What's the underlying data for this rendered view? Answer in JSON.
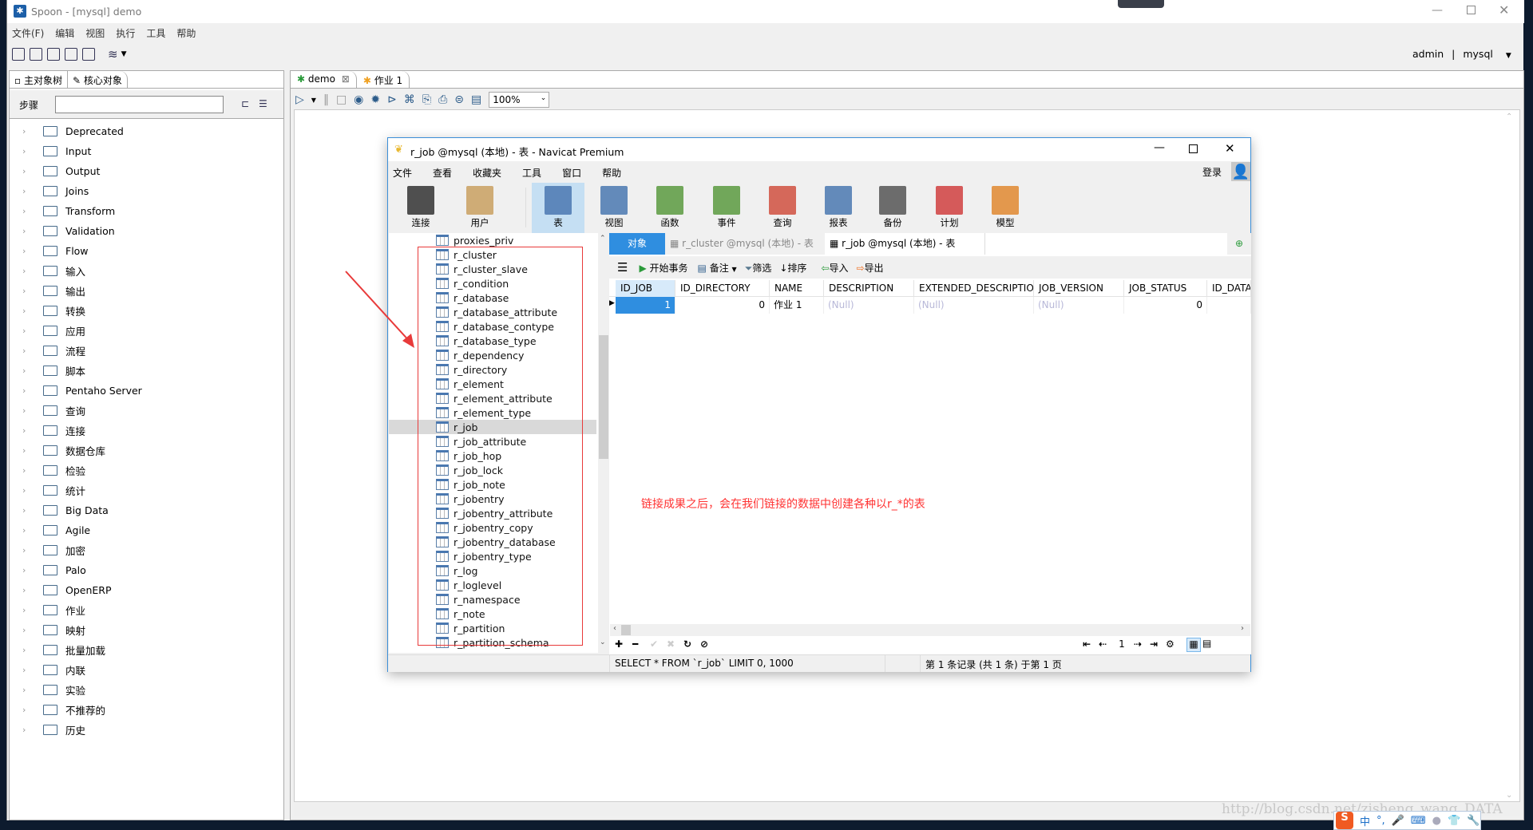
{
  "spoon": {
    "title": "Spoon - [mysql] demo",
    "menu": [
      "文件(F)",
      "编辑",
      "视图",
      "执行",
      "工具",
      "帮助"
    ],
    "user": "admin",
    "separator": "|",
    "repository": "mysql",
    "left_tabs": [
      "主对象树",
      "核心对象"
    ],
    "steps_label": "步骤",
    "steps_search_value": "",
    "tree": [
      "Deprecated",
      "Input",
      "Output",
      "Joins",
      "Transform",
      "Validation",
      "Flow",
      "输入",
      "输出",
      "转换",
      "应用",
      "流程",
      "脚本",
      "Pentaho Server",
      "查询",
      "连接",
      "数据仓库",
      "检验",
      "统计",
      "Big Data",
      "Agile",
      "加密",
      "Palo",
      "OpenERP",
      "作业",
      "映射",
      "批量加载",
      "内联",
      "实验",
      "不推荐的",
      "历史"
    ],
    "editor_tabs": [
      {
        "label": "demo",
        "closable": true
      },
      {
        "label": "作业 1",
        "closable": false
      }
    ],
    "zoom": "100%"
  },
  "navicat": {
    "title": "r_job @mysql (本地) - 表 - Navicat Premium",
    "menu": [
      "文件",
      "查看",
      "收藏夹",
      "工具",
      "窗口",
      "帮助"
    ],
    "login": "登录",
    "toolbar": [
      {
        "label": "连接",
        "icon": "connection-icon"
      },
      {
        "label": "用户",
        "icon": "user-icon"
      },
      {
        "label": "表",
        "icon": "table-icon",
        "active": true
      },
      {
        "label": "视图",
        "icon": "view-icon"
      },
      {
        "label": "函数",
        "icon": "function-icon"
      },
      {
        "label": "事件",
        "icon": "event-icon"
      },
      {
        "label": "查询",
        "icon": "query-icon"
      },
      {
        "label": "报表",
        "icon": "report-icon"
      },
      {
        "label": "备份",
        "icon": "backup-icon"
      },
      {
        "label": "计划",
        "icon": "schedule-icon"
      },
      {
        "label": "模型",
        "icon": "model-icon"
      }
    ],
    "tables": [
      "proxies_priv",
      "r_cluster",
      "r_cluster_slave",
      "r_condition",
      "r_database",
      "r_database_attribute",
      "r_database_contype",
      "r_database_type",
      "r_dependency",
      "r_directory",
      "r_element",
      "r_element_attribute",
      "r_element_type",
      "r_job",
      "r_job_attribute",
      "r_job_hop",
      "r_job_lock",
      "r_job_note",
      "r_jobentry",
      "r_jobentry_attribute",
      "r_jobentry_copy",
      "r_jobentry_database",
      "r_jobentry_type",
      "r_log",
      "r_loglevel",
      "r_namespace",
      "r_note",
      "r_partition",
      "r_partition_schema"
    ],
    "selected_table": "r_job",
    "tabs": [
      "对象",
      "r_cluster @mysql (本地) - 表",
      "r_job @mysql (本地) - 表"
    ],
    "grid_toolbar": [
      "开始事务",
      "备注",
      "筛选",
      "排序",
      "导入",
      "导出"
    ],
    "columns": [
      "ID_JOB",
      "ID_DIRECTORY",
      "NAME",
      "DESCRIPTION",
      "EXTENDED_DESCRIPTION",
      "JOB_VERSION",
      "JOB_STATUS",
      "ID_DATA"
    ],
    "rows": [
      [
        "1",
        "0",
        "作业 1",
        "(Null)",
        "(Null)",
        "(Null)",
        "0",
        ""
      ]
    ],
    "page": "1",
    "sql": "SELECT * FROM `r_job` LIMIT 0, 1000",
    "record_info": "第 1 条记录 (共 1 条) 于第 1 页"
  },
  "annotation": {
    "text": "链接成果之后，会在我们链接的数据中创建各种以r_*的表",
    "color": "#ff3333"
  },
  "watermark": "http://blog.csdn.net/zisheng_wang_DATA",
  "ime": [
    "中",
    "°,"
  ]
}
